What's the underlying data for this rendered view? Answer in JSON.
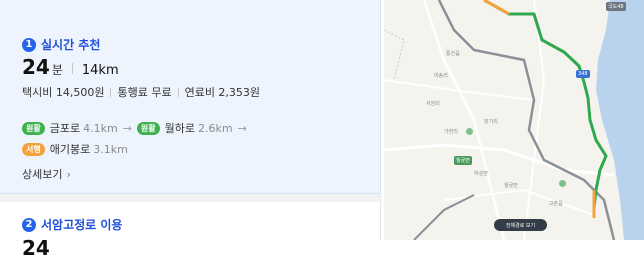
{
  "routes": [
    {
      "rank": "1",
      "title": "실시간 추천",
      "time_value": "24",
      "time_unit": "분",
      "distance": "14km",
      "taxi": "택시비 14,500원",
      "toll": "통행료 무료",
      "fuel": "연료비 2,353원",
      "roads_line1": [
        {
          "badge": "원활",
          "name": "금포로",
          "dist": "4.1km",
          "color": "green"
        },
        {
          "badge": "원활",
          "name": "월하로",
          "dist": "2.6km",
          "color": "green"
        }
      ],
      "roads_line2": [
        {
          "badge": "서행",
          "name": "애기봉로",
          "dist": "3.1km",
          "color": "orange"
        }
      ],
      "detail_label": "상세보기"
    },
    {
      "rank": "2",
      "title": "서암고정로 이용",
      "time_value": "24"
    }
  ],
  "map": {
    "labels": [
      "통진읍",
      "마송리",
      "서암리",
      "가현리",
      "하성면",
      "월곶면",
      "장기리",
      "고촌읍"
    ],
    "tags": [
      "348",
      "월곶면",
      "국도48"
    ],
    "view_button": "전체경로 보기"
  }
}
